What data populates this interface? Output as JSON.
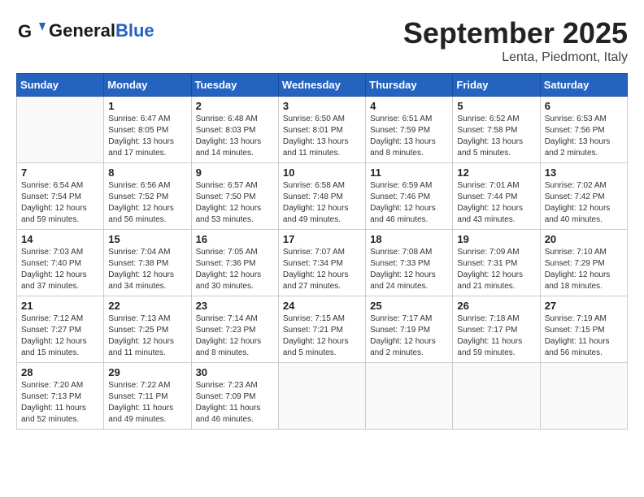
{
  "header": {
    "logo_general": "General",
    "logo_blue": "Blue",
    "month": "September 2025",
    "location": "Lenta, Piedmont, Italy"
  },
  "weekdays": [
    "Sunday",
    "Monday",
    "Tuesday",
    "Wednesday",
    "Thursday",
    "Friday",
    "Saturday"
  ],
  "weeks": [
    [
      {
        "day": "",
        "info": ""
      },
      {
        "day": "1",
        "info": "Sunrise: 6:47 AM\nSunset: 8:05 PM\nDaylight: 13 hours\nand 17 minutes."
      },
      {
        "day": "2",
        "info": "Sunrise: 6:48 AM\nSunset: 8:03 PM\nDaylight: 13 hours\nand 14 minutes."
      },
      {
        "day": "3",
        "info": "Sunrise: 6:50 AM\nSunset: 8:01 PM\nDaylight: 13 hours\nand 11 minutes."
      },
      {
        "day": "4",
        "info": "Sunrise: 6:51 AM\nSunset: 7:59 PM\nDaylight: 13 hours\nand 8 minutes."
      },
      {
        "day": "5",
        "info": "Sunrise: 6:52 AM\nSunset: 7:58 PM\nDaylight: 13 hours\nand 5 minutes."
      },
      {
        "day": "6",
        "info": "Sunrise: 6:53 AM\nSunset: 7:56 PM\nDaylight: 13 hours\nand 2 minutes."
      }
    ],
    [
      {
        "day": "7",
        "info": "Sunrise: 6:54 AM\nSunset: 7:54 PM\nDaylight: 12 hours\nand 59 minutes."
      },
      {
        "day": "8",
        "info": "Sunrise: 6:56 AM\nSunset: 7:52 PM\nDaylight: 12 hours\nand 56 minutes."
      },
      {
        "day": "9",
        "info": "Sunrise: 6:57 AM\nSunset: 7:50 PM\nDaylight: 12 hours\nand 53 minutes."
      },
      {
        "day": "10",
        "info": "Sunrise: 6:58 AM\nSunset: 7:48 PM\nDaylight: 12 hours\nand 49 minutes."
      },
      {
        "day": "11",
        "info": "Sunrise: 6:59 AM\nSunset: 7:46 PM\nDaylight: 12 hours\nand 46 minutes."
      },
      {
        "day": "12",
        "info": "Sunrise: 7:01 AM\nSunset: 7:44 PM\nDaylight: 12 hours\nand 43 minutes."
      },
      {
        "day": "13",
        "info": "Sunrise: 7:02 AM\nSunset: 7:42 PM\nDaylight: 12 hours\nand 40 minutes."
      }
    ],
    [
      {
        "day": "14",
        "info": "Sunrise: 7:03 AM\nSunset: 7:40 PM\nDaylight: 12 hours\nand 37 minutes."
      },
      {
        "day": "15",
        "info": "Sunrise: 7:04 AM\nSunset: 7:38 PM\nDaylight: 12 hours\nand 34 minutes."
      },
      {
        "day": "16",
        "info": "Sunrise: 7:05 AM\nSunset: 7:36 PM\nDaylight: 12 hours\nand 30 minutes."
      },
      {
        "day": "17",
        "info": "Sunrise: 7:07 AM\nSunset: 7:34 PM\nDaylight: 12 hours\nand 27 minutes."
      },
      {
        "day": "18",
        "info": "Sunrise: 7:08 AM\nSunset: 7:33 PM\nDaylight: 12 hours\nand 24 minutes."
      },
      {
        "day": "19",
        "info": "Sunrise: 7:09 AM\nSunset: 7:31 PM\nDaylight: 12 hours\nand 21 minutes."
      },
      {
        "day": "20",
        "info": "Sunrise: 7:10 AM\nSunset: 7:29 PM\nDaylight: 12 hours\nand 18 minutes."
      }
    ],
    [
      {
        "day": "21",
        "info": "Sunrise: 7:12 AM\nSunset: 7:27 PM\nDaylight: 12 hours\nand 15 minutes."
      },
      {
        "day": "22",
        "info": "Sunrise: 7:13 AM\nSunset: 7:25 PM\nDaylight: 12 hours\nand 11 minutes."
      },
      {
        "day": "23",
        "info": "Sunrise: 7:14 AM\nSunset: 7:23 PM\nDaylight: 12 hours\nand 8 minutes."
      },
      {
        "day": "24",
        "info": "Sunrise: 7:15 AM\nSunset: 7:21 PM\nDaylight: 12 hours\nand 5 minutes."
      },
      {
        "day": "25",
        "info": "Sunrise: 7:17 AM\nSunset: 7:19 PM\nDaylight: 12 hours\nand 2 minutes."
      },
      {
        "day": "26",
        "info": "Sunrise: 7:18 AM\nSunset: 7:17 PM\nDaylight: 11 hours\nand 59 minutes."
      },
      {
        "day": "27",
        "info": "Sunrise: 7:19 AM\nSunset: 7:15 PM\nDaylight: 11 hours\nand 56 minutes."
      }
    ],
    [
      {
        "day": "28",
        "info": "Sunrise: 7:20 AM\nSunset: 7:13 PM\nDaylight: 11 hours\nand 52 minutes."
      },
      {
        "day": "29",
        "info": "Sunrise: 7:22 AM\nSunset: 7:11 PM\nDaylight: 11 hours\nand 49 minutes."
      },
      {
        "day": "30",
        "info": "Sunrise: 7:23 AM\nSunset: 7:09 PM\nDaylight: 11 hours\nand 46 minutes."
      },
      {
        "day": "",
        "info": ""
      },
      {
        "day": "",
        "info": ""
      },
      {
        "day": "",
        "info": ""
      },
      {
        "day": "",
        "info": ""
      }
    ]
  ]
}
